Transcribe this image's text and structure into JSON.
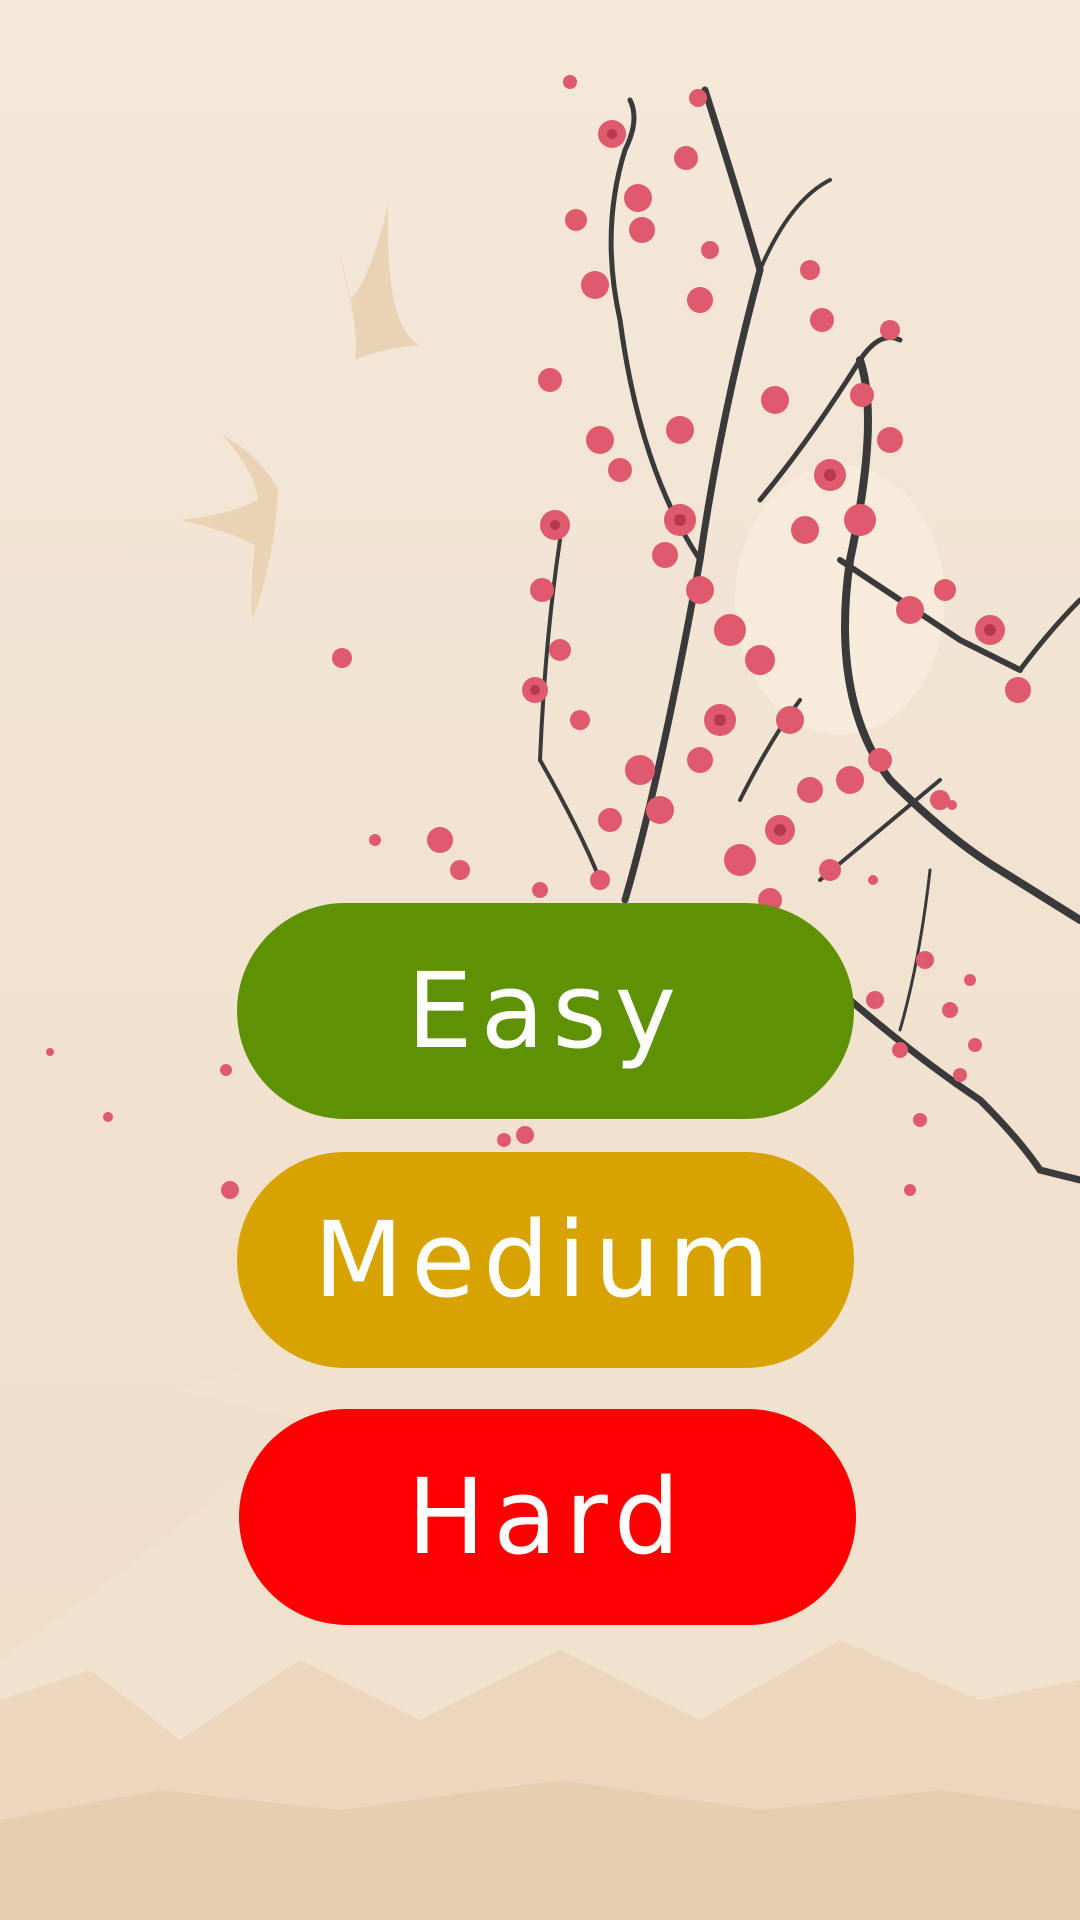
{
  "menu": {
    "buttons": [
      {
        "label": "Easy",
        "color": "#5e9204"
      },
      {
        "label": "Medium",
        "color": "#d8a300"
      },
      {
        "label": "Hard",
        "color": "#ff0000"
      }
    ]
  },
  "background": {
    "sky_color": "#f3e6d6",
    "mountain_color": "#ead0b4",
    "blossom_color": "#e05a6e",
    "branch_color": "#3a3a3a",
    "bird_color": "#e8cfae"
  }
}
